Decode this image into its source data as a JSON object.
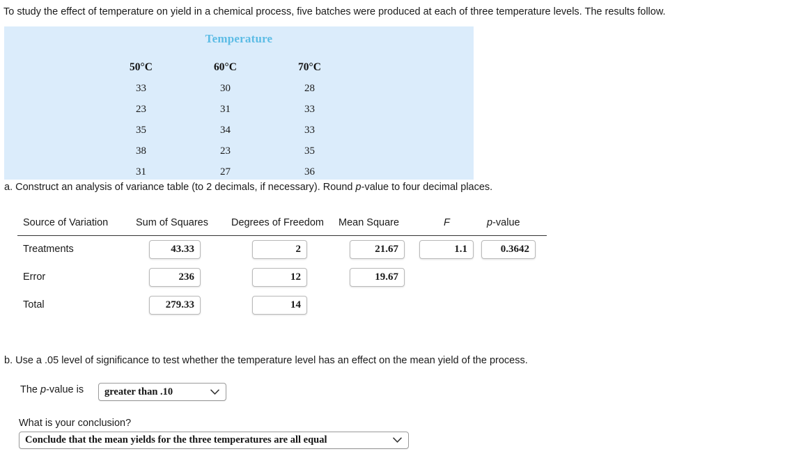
{
  "intro": {
    "text": "To study the effect of temperature on yield in a chemical process, five batches were produced at each of three temperature levels. The results follow."
  },
  "data_panel": {
    "title": "Temperature",
    "columns": [
      "50°C",
      "60°C",
      "70°C"
    ],
    "rows": [
      [
        "33",
        "30",
        "28"
      ],
      [
        "23",
        "31",
        "33"
      ],
      [
        "35",
        "34",
        "33"
      ],
      [
        "38",
        "23",
        "35"
      ],
      [
        "31",
        "27",
        "36"
      ]
    ]
  },
  "part_a": {
    "prompt_before": "a. Construct an analysis of variance table (to 2 decimals, if necessary). Round ",
    "prompt_italic": "p",
    "prompt_after": "-value to four decimal places.",
    "headers": {
      "source": "Source of Variation",
      "sum_of_squares": "Sum of Squares",
      "degrees_of_freedom": "Degrees of Freedom",
      "mean_square": "Mean Square",
      "f": "F",
      "p_value_italic": "p",
      "p_value_rest": "-value"
    },
    "rows": [
      {
        "label": "Treatments",
        "sum_of_squares": "43.33",
        "degrees_of_freedom": "2",
        "mean_square": "21.67",
        "f": "1.1",
        "p_value": "0.3642"
      },
      {
        "label": "Error",
        "sum_of_squares": "236",
        "degrees_of_freedom": "12",
        "mean_square": "19.67",
        "f": "",
        "p_value": ""
      },
      {
        "label": "Total",
        "sum_of_squares": "279.33",
        "degrees_of_freedom": "14",
        "mean_square": "",
        "f": "",
        "p_value": ""
      }
    ]
  },
  "part_b": {
    "prompt": "b. Use a .05 level of significance to test whether the temperature level has an effect on the mean yield of the process.",
    "pvalue_label_before": "The ",
    "pvalue_label_italic": "p",
    "pvalue_label_after": "-value is",
    "pvalue_select": {
      "value": "greater than .10",
      "chevron": "chevron-down-icon"
    },
    "conclusion_question": "What is your conclusion?",
    "conclusion_select": {
      "value": "Conclude that the mean yields for the three temperatures are all equal",
      "chevron": "chevron-down-icon"
    }
  },
  "colors": {
    "panel_background": "#dbecfb",
    "panel_title": "#5cbce5",
    "text": "#1a1a1a",
    "input_border": "#b9b9b9",
    "select_border": "#9a9a9a"
  }
}
